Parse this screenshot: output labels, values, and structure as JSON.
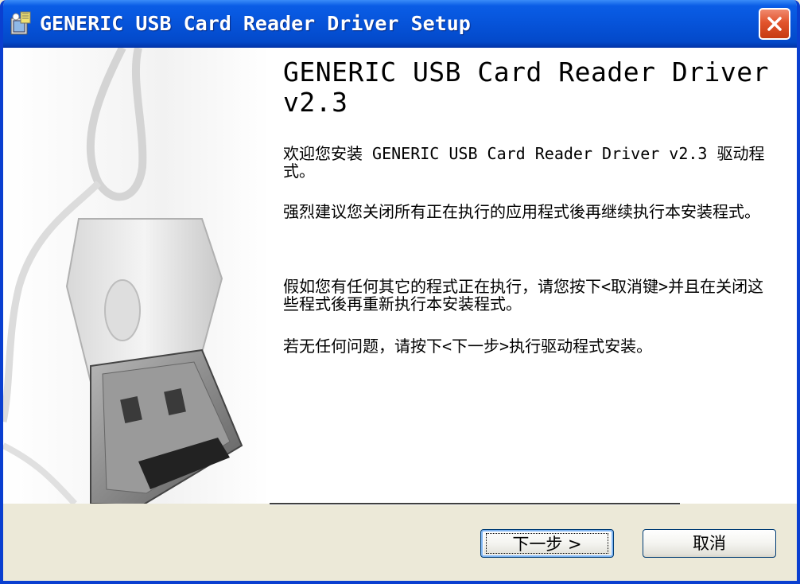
{
  "window": {
    "title": "GENERIC USB Card Reader Driver Setup"
  },
  "icons": {
    "app": "setup-app-icon",
    "close": "close-icon"
  },
  "welcome": {
    "heading": "GENERIC USB Card Reader Driver v2.3",
    "paragraphs": [
      "欢迎您安装 GENERIC USB Card Reader Driver v2.3 驱动程式。",
      "强烈建议您关闭所有正在执行的应用程式後再继续执行本安装程式。",
      "假如您有任何其它的程式正在执行，请您按下<取消键>并且在关闭这些程式後再重新执行本安装程式。",
      "若无任何问题，请按下<下一步>执行驱动程式安装。"
    ]
  },
  "buttons": {
    "next": "下一步 >",
    "cancel": "取消"
  },
  "colors": {
    "titlebar": "#0653d9",
    "close": "#e2542c",
    "dialog_bg": "#ece9d8"
  }
}
